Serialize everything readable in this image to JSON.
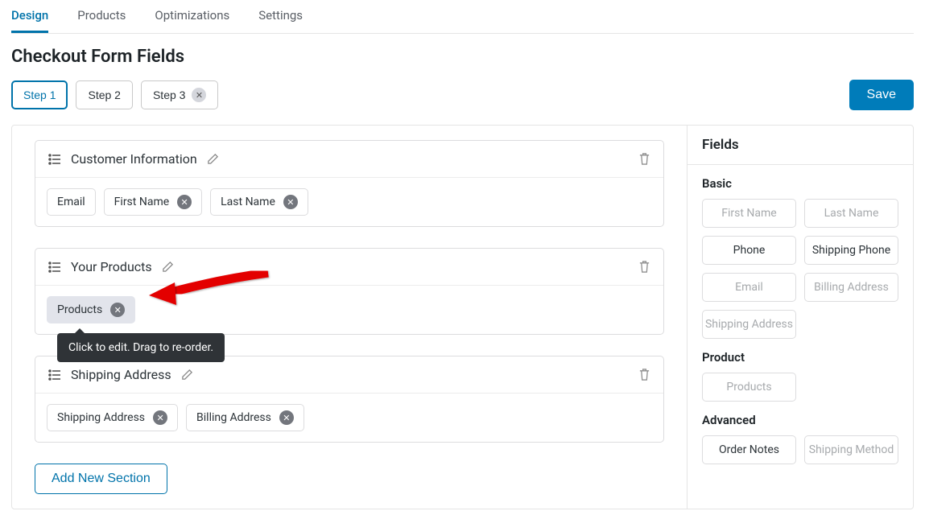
{
  "tabs": [
    "Design",
    "Products",
    "Optimizations",
    "Settings"
  ],
  "page_title": "Checkout Form Fields",
  "steps": [
    {
      "label": "Step 1"
    },
    {
      "label": "Step 2"
    },
    {
      "label": "Step 3"
    }
  ],
  "save_label": "Save",
  "sections": [
    {
      "title": "Customer Information",
      "fields": [
        {
          "label": "Email",
          "removable": false
        },
        {
          "label": "First Name",
          "removable": true
        },
        {
          "label": "Last Name",
          "removable": true
        }
      ]
    },
    {
      "title": "Your Products",
      "fields": [
        {
          "label": "Products",
          "removable": true,
          "highlight": true
        }
      ]
    },
    {
      "title": "Shipping Address",
      "fields": [
        {
          "label": "Shipping Address",
          "removable": true
        },
        {
          "label": "Billing Address",
          "removable": true
        }
      ]
    }
  ],
  "tooltip_text": "Click to edit. Drag to re-order.",
  "add_section_label": "Add New Section",
  "sidebar": {
    "heading": "Fields",
    "groups": [
      {
        "label": "Basic",
        "fields": [
          {
            "label": "First Name",
            "disabled": true
          },
          {
            "label": "Last Name",
            "disabled": true
          },
          {
            "label": "Phone",
            "disabled": false
          },
          {
            "label": "Shipping Phone",
            "disabled": false
          },
          {
            "label": "Email",
            "disabled": true
          },
          {
            "label": "Billing Address",
            "disabled": true
          },
          {
            "label": "Shipping Address",
            "disabled": true
          }
        ]
      },
      {
        "label": "Product",
        "fields": [
          {
            "label": "Products",
            "disabled": true
          }
        ]
      },
      {
        "label": "Advanced",
        "fields": [
          {
            "label": "Order Notes",
            "disabled": false
          },
          {
            "label": "Shipping Method",
            "disabled": true
          }
        ]
      }
    ]
  }
}
